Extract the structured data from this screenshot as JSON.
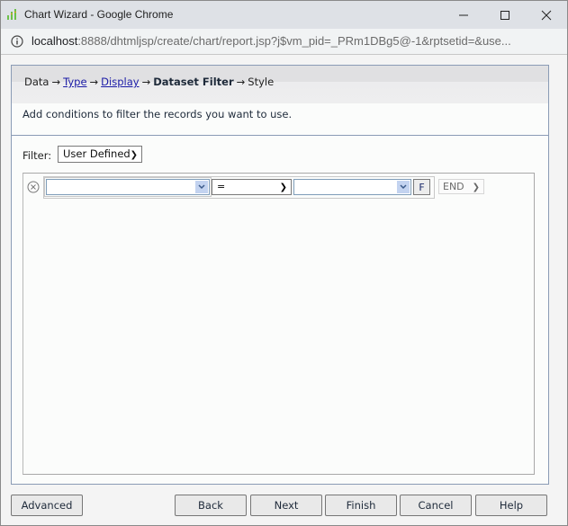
{
  "window": {
    "title": "Chart Wizard - Google Chrome",
    "controls": {
      "minimize": "minimize",
      "maximize": "maximize",
      "close": "close"
    }
  },
  "addressbar": {
    "host": "localhost",
    "rest": ":8888/dhtmljsp/create/chart/report.jsp?j$vm_pid=_PRm1DBg5@-1&rptsetid=&use..."
  },
  "steps": {
    "items": [
      {
        "label": "Data",
        "state": "plain"
      },
      {
        "label": "Type",
        "state": "link"
      },
      {
        "label": "Display",
        "state": "link"
      },
      {
        "label": "Dataset Filter",
        "state": "current"
      },
      {
        "label": "Style",
        "state": "plain"
      }
    ],
    "arrow": "→"
  },
  "description": "Add conditions to filter the records you want to use.",
  "filter": {
    "label": "Filter:",
    "selected": "User Defined"
  },
  "condition_row": {
    "field_value": "",
    "operator": "=",
    "value": "",
    "f_button": "F",
    "logic": "END"
  },
  "buttons": {
    "advanced": "Advanced",
    "back": "Back",
    "next": "Next",
    "finish": "Finish",
    "cancel": "Cancel",
    "help": "Help"
  }
}
